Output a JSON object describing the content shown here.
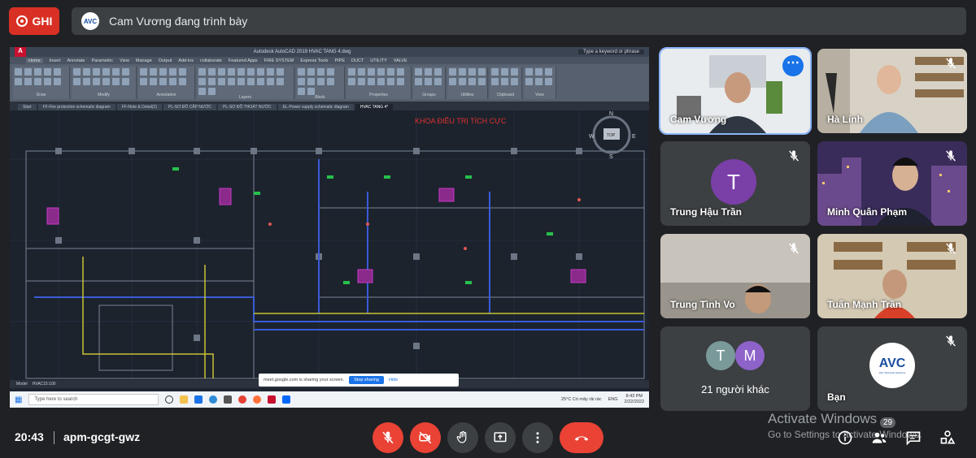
{
  "top": {
    "record_label": "GHI",
    "presenter_text": "Cam Vương đang trình bày",
    "mini_logo_text": "AVC"
  },
  "shared_screen": {
    "acad_title": "Autodesk AutoCAD 2019   HVAC TANG 4.dwg",
    "acad_search": "Type a keyword or phrase",
    "ribbon_tabs": [
      "Home",
      "Insert",
      "Annotate",
      "Parametric",
      "View",
      "Manage",
      "Output",
      "Add-ins",
      "collaborate",
      "Featured Apps",
      "FIRE SYSTEM",
      "Express Tools",
      "PIPE",
      "DUCT",
      "UTILITY",
      "VALVE"
    ],
    "ribbon_groups": [
      "Draw",
      "Modify",
      "Annotation",
      "Layers",
      "Block",
      "Properties",
      "Groups",
      "Utilities",
      "Clipboard",
      "View"
    ],
    "doc_tabs": [
      "Start",
      "FF-Fire protection schematic diagram",
      "FF-Note & Detail(2)",
      "PL-SƠ ĐỒ CẤP NƯỚC",
      "PL-SƠ ĐỒ THOÁT NƯỚC",
      "EL-Power supply schematic diagram",
      "HVAC TANG 4*"
    ],
    "drawing_title": "KHOA ĐIỀU TRỊ TÍCH CỰC",
    "viewcube": {
      "n": "N",
      "s": "S",
      "e": "E",
      "w": "W",
      "top": "TOP"
    },
    "model_tabs": [
      "Model",
      "HVAC15:100"
    ],
    "share_banner": {
      "text": "meet.google.com is sharing your screen.",
      "stop": "Stop sharing",
      "hide": "Hide"
    },
    "taskbar": {
      "search": "Type here to search",
      "weather": "25°C Có mây rải rác",
      "lang": "ENG",
      "time": "8:43 PM",
      "date": "2/22/2022"
    }
  },
  "participants": [
    {
      "name": "Cam Vương",
      "type": "video",
      "active": true
    },
    {
      "name": "Hà Linh",
      "type": "video",
      "muted": true
    },
    {
      "name": "Trung Hậu Trần",
      "type": "avatar",
      "initial": "T",
      "muted": true
    },
    {
      "name": "Minh Quân Phạm",
      "type": "video",
      "muted": true
    },
    {
      "name": "Trung Tình Vo",
      "type": "video",
      "muted": true
    },
    {
      "name": "Tuấn Mạnh Trần",
      "type": "video",
      "muted": true
    },
    {
      "name": "21 người khác",
      "type": "others",
      "initials": [
        "T",
        "M"
      ]
    },
    {
      "name": "Bạn",
      "type": "logo",
      "muted": true,
      "logo_text": "AVC",
      "logo_sub": "AVC Technical Solutions"
    }
  ],
  "bottom": {
    "time": "20:43",
    "meeting_code": "apm-gcgt-gwz",
    "people_count": "29",
    "activate_title": "Activate Windows",
    "activate_sub": "Go to Settings to activate Windows."
  },
  "colors": {
    "record_red": "#d93025",
    "control_red": "#ea4335",
    "active_outline": "#8ab4f8",
    "avatar_purple": "#7b3fa8",
    "avatar_teal": "#7a9a9a",
    "avatar_violet": "#8e63c9"
  }
}
